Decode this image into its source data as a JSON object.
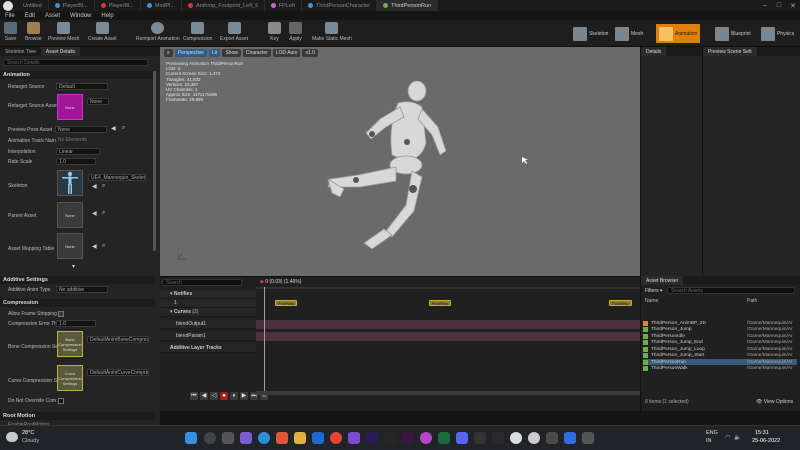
{
  "titlebar": {
    "tabs": [
      {
        "label": "Untitled",
        "active": false
      },
      {
        "label": "PlayerBl...",
        "active": false
      },
      {
        "label": "PlayerBl...",
        "active": false
      },
      {
        "label": "ModPl...",
        "active": false
      },
      {
        "label": "Anthrop_Footprint_Left_ll",
        "active": false
      },
      {
        "label": "FPLeft",
        "active": false
      },
      {
        "label": "ThirdPersonCharacter",
        "active": false
      },
      {
        "label": "ThirdPersonRun",
        "active": true
      }
    ]
  },
  "menu": [
    "File",
    "Edit",
    "Asset",
    "Window",
    "Help"
  ],
  "toolbar": {
    "buttons": [
      "Save",
      "Browse",
      "Preview Mesh",
      "Create Asset",
      "Reimport Animation",
      "Compression",
      "Export Asset",
      "Key",
      "Apply",
      "Make Static Mesh"
    ],
    "modes": [
      {
        "label": "Skeleton",
        "active": false
      },
      {
        "label": "Mesh",
        "active": false
      },
      {
        "label": "Animation",
        "active": true
      },
      {
        "label": "Blueprint",
        "active": false
      },
      {
        "label": "Physics",
        "active": false
      }
    ]
  },
  "left_panel": {
    "tabs": [
      "Skeleton Tree",
      "Asset Details"
    ],
    "search_placeholder": "Search Details",
    "sections": {
      "animation": "Animation",
      "additive": "Additive Settings",
      "compression": "Compression",
      "root_motion": "Root Motion"
    },
    "props": {
      "retarget_source": {
        "label": "Retarget Source",
        "value": "Default"
      },
      "retarget_source_asset": {
        "label": "Retarget Source Asse",
        "value": "None"
      },
      "preview_pose_asset": {
        "label": "Preview Pose Asset",
        "value": "None"
      },
      "animation_track_names": {
        "label": "Animation Track Nam",
        "value": "No Elements"
      },
      "interpolation": {
        "label": "Interpolation",
        "value": "Linear"
      },
      "rate_scale": {
        "label": "Rate Scale",
        "value": "1.0"
      },
      "skeleton": {
        "label": "Skeleton",
        "value": "UE4_Mannequin_Skeleton"
      },
      "parent_asset": {
        "label": "Parent Asset",
        "value": "None"
      },
      "asset_mapping_table": {
        "label": "Asset Mapping Table",
        "value": "None"
      },
      "additive_anim_type": {
        "label": "Additive Anim Type",
        "value": "No additive"
      },
      "allow_frame_stripping": {
        "label": "Allow Frame Stripping"
      },
      "compression_error_th": {
        "label": "Compression Error Th",
        "value": "1.0"
      },
      "bone_compression_settings": {
        "label": "Bone Compression Se",
        "value": "DefaultAnimBoneCompress"
      },
      "curve_compression_settings": {
        "label": "Curve Compression S",
        "value": "DefaultAnimCurveCompres"
      },
      "do_not_override_comp": {
        "label": "Do Not Override Com"
      },
      "enable_root_motion": {
        "label": "EnableRootMotion"
      }
    },
    "thumbs": {
      "retarget": "None",
      "bone_compression": "Bone Compression Settings",
      "curve_compression": "Curve Compression Settings"
    }
  },
  "viewport": {
    "buttons": [
      "Perspective",
      "Lit",
      "Show",
      "Character",
      "LOD Auto",
      "x1.0"
    ],
    "info_lines": [
      "Previewing Animation ThirdPersonRun",
      "LOD: 0",
      "Current Screen Size: 1.473",
      "Triangles: 41,822",
      "Vertices: 23,367",
      "UV Channels: 1",
      "Approx Size: 117x178x98",
      "Framerate: 29.999"
    ]
  },
  "details_panel": {
    "title": "Details"
  },
  "preview_panel": {
    "title": "Preview Scene Sett"
  },
  "timeline": {
    "search_placeholder": "Search",
    "frame_label": "0 (0.03) (1.46%)",
    "rows": {
      "notifies": "Notifies",
      "notify_track": "1",
      "curves": "Curves",
      "curves_count": "(2)",
      "curve1": "blendOutput1",
      "curve2": "blendParam1",
      "additive": "Additive Layer Tracks"
    },
    "notifies": [
      {
        "label": "FootStep",
        "pos": 0.05
      },
      {
        "label": "FootStep",
        "pos": 0.45
      },
      {
        "label": "FootStep",
        "pos": 0.92
      }
    ]
  },
  "asset_browser": {
    "title": "Asset Browser",
    "filters": "Filters",
    "search_placeholder": "Search Assets",
    "columns": [
      "Name",
      "Path"
    ],
    "items": [
      {
        "name": "ThirdPerson_AnimBP_2D",
        "path": "/Game/Mannequin/Ar",
        "selected": false
      },
      {
        "name": "ThirdPerson_Jump",
        "path": "/Game/Mannequin/Ar",
        "selected": false
      },
      {
        "name": "ThirdPersonIdle",
        "path": "/Game/Mannequin/Ar",
        "selected": false
      },
      {
        "name": "ThirdPerson_Jump_End",
        "path": "/Game/Mannequin/Ar",
        "selected": false
      },
      {
        "name": "ThirdPerson_Jump_Loop",
        "path": "/Game/Mannequin/Ar",
        "selected": false
      },
      {
        "name": "ThirdPerson_Jump_Start",
        "path": "/Game/Mannequin/Ar",
        "selected": false
      },
      {
        "name": "ThirdPersonRun",
        "path": "/Game/Mannequin/Ar",
        "selected": true
      },
      {
        "name": "ThirdPersonWalk",
        "path": "/Game/Mannequin/Ar",
        "selected": false
      }
    ],
    "footer": "8 items (1 selected)",
    "view_options": "View Options"
  },
  "taskbar": {
    "weather_temp": "28°C",
    "weather_desc": "Cloudy",
    "lang": "ENG",
    "region": "IN",
    "time": "15:31",
    "date": "25-06-2022"
  },
  "colors": {
    "accent_orange": "#e0800c",
    "notify_fill": "#8a7a30",
    "viewport_bg": "#6a6a6a",
    "selection_blue": "#3a5a7a"
  }
}
